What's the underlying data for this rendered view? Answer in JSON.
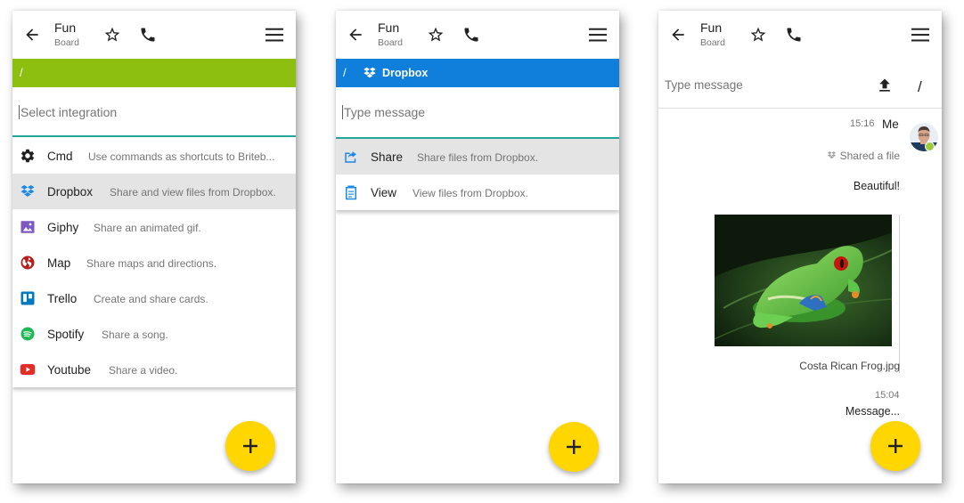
{
  "app": {
    "title": "Fun",
    "subtitle": "Board",
    "fab_icon": "plus-icon",
    "colors": {
      "path_green": "#8cbf0f",
      "path_blue": "#0f7fdb",
      "fab": "#ffd600",
      "underline": "#26a69a",
      "selected_row": "#e4e4e4"
    }
  },
  "screen1": {
    "path": "/",
    "input_placeholder": "Select integration",
    "integrations": [
      {
        "name": "Cmd",
        "desc": "Use commands as shortcuts to Briteb...",
        "icon": "gear-icon",
        "selected": false
      },
      {
        "name": "Dropbox",
        "desc": "Share and view files from Dropbox.",
        "icon": "dropbox-icon",
        "selected": true
      },
      {
        "name": "Giphy",
        "desc": "Share an animated gif.",
        "icon": "image-icon",
        "selected": false
      },
      {
        "name": "Map",
        "desc": "Share maps and directions.",
        "icon": "globe-icon",
        "selected": false
      },
      {
        "name": "Trello",
        "desc": "Create and share cards.",
        "icon": "trello-icon",
        "selected": false
      },
      {
        "name": "Spotify",
        "desc": "Share a song.",
        "icon": "spotify-icon",
        "selected": false
      },
      {
        "name": "Youtube",
        "desc": "Share a video.",
        "icon": "youtube-icon",
        "selected": false
      }
    ]
  },
  "screen2": {
    "path_slash": "/",
    "path_name": "Dropbox",
    "input_placeholder": "Type message",
    "actions": [
      {
        "name": "Share",
        "desc": "Share files from Dropbox.",
        "icon": "share-icon",
        "selected": true
      },
      {
        "name": "View",
        "desc": "View files from Dropbox.",
        "icon": "clipboard-icon",
        "selected": false
      }
    ]
  },
  "screen3": {
    "input_placeholder": "Type message",
    "slash": "/",
    "message1": {
      "time": "15:16",
      "sender": "Me",
      "shared_label": "Shared a file",
      "text": "Beautiful!",
      "file_caption": "Costa Rican Frog.jpg"
    },
    "message2": {
      "time": "15:04",
      "text": "Message..."
    }
  }
}
